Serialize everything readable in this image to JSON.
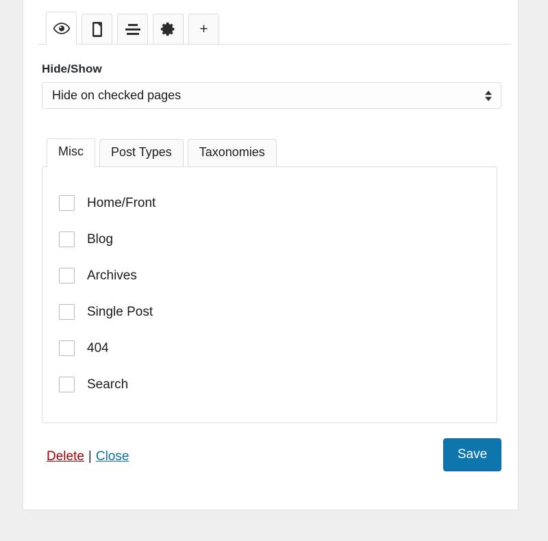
{
  "icon_tabs": [
    {
      "name": "visibility",
      "icon": "eye-icon",
      "active": true
    },
    {
      "name": "device",
      "icon": "mobile-device-icon",
      "active": false
    },
    {
      "name": "alignment",
      "icon": "align-lines-icon",
      "active": false
    },
    {
      "name": "settings",
      "icon": "gear-icon",
      "active": false
    },
    {
      "name": "add",
      "icon": "plus-icon",
      "active": false,
      "glyph": "+"
    }
  ],
  "hide_show": {
    "label": "Hide/Show",
    "selected": "Hide on checked pages"
  },
  "subtabs": [
    {
      "label": "Misc",
      "active": true
    },
    {
      "label": "Post Types",
      "active": false
    },
    {
      "label": "Taxonomies",
      "active": false
    }
  ],
  "checkboxes": [
    {
      "label": "Home/Front",
      "checked": false
    },
    {
      "label": "Blog",
      "checked": false
    },
    {
      "label": "Archives",
      "checked": false
    },
    {
      "label": "Single Post",
      "checked": false
    },
    {
      "label": "404",
      "checked": false
    },
    {
      "label": "Search",
      "checked": false
    }
  ],
  "footer": {
    "delete_label": "Delete",
    "separator": "|",
    "close_label": "Close",
    "save_label": "Save"
  },
  "colors": {
    "delete_link": "#a00000",
    "close_link": "#0b6ea8",
    "save_button": "#0f76ad",
    "page_background": "#efefef"
  }
}
